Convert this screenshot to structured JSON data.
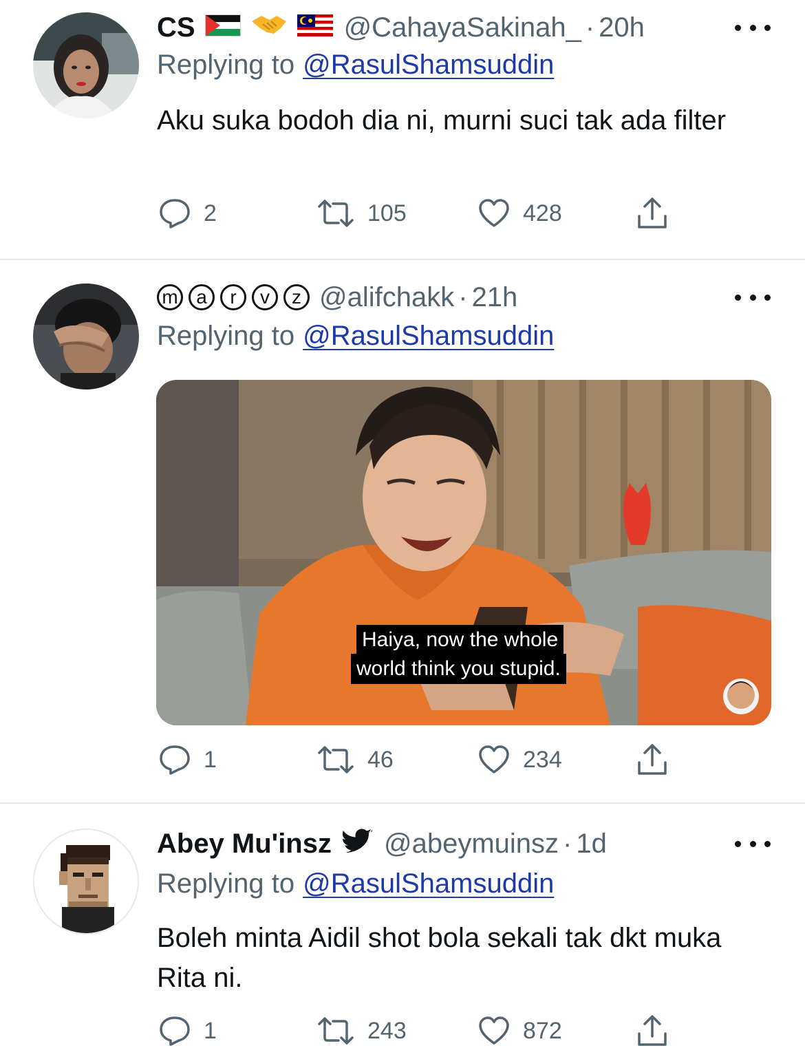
{
  "tweets": [
    {
      "name": "CS",
      "handle": "@CahayaSakinah_",
      "time": "20h",
      "reply_label": "Replying to",
      "reply_to": "@RasulShamsuddin",
      "text": "Aku suka bodoh dia ni, murni suci tak ada filter",
      "replies": "2",
      "retweets": "105",
      "likes": "428"
    },
    {
      "name_letters": [
        "m",
        "a",
        "r",
        "v",
        "z"
      ],
      "handle": "@alifchakk",
      "time": "21h",
      "reply_label": "Replying to",
      "reply_to": "@RasulShamsuddin",
      "media_caption_line1": "Haiya, now the whole",
      "media_caption_line2": "world think you stupid.",
      "replies": "1",
      "retweets": "46",
      "likes": "234"
    },
    {
      "name": "Abey Mu'insz",
      "handle": "@abeymuinsz",
      "time": "1d",
      "reply_label": "Replying to",
      "reply_to": "@RasulShamsuddin",
      "text": "Boleh minta Aidil shot bola sekali tak dkt muka Rita ni.",
      "replies": "1",
      "retweets": "243",
      "likes": "872"
    }
  ],
  "separator": "·",
  "icons": [
    "more-icon",
    "reply-icon",
    "retweet-icon",
    "like-icon",
    "share-icon",
    "palestine-flag-icon",
    "handshake-icon",
    "malaysia-flag-icon",
    "bird-icon"
  ],
  "colors": {
    "text": "#0f1419",
    "secondary": "#536471",
    "mention": "#1d3aa8",
    "divider": "#e6e6e6"
  }
}
